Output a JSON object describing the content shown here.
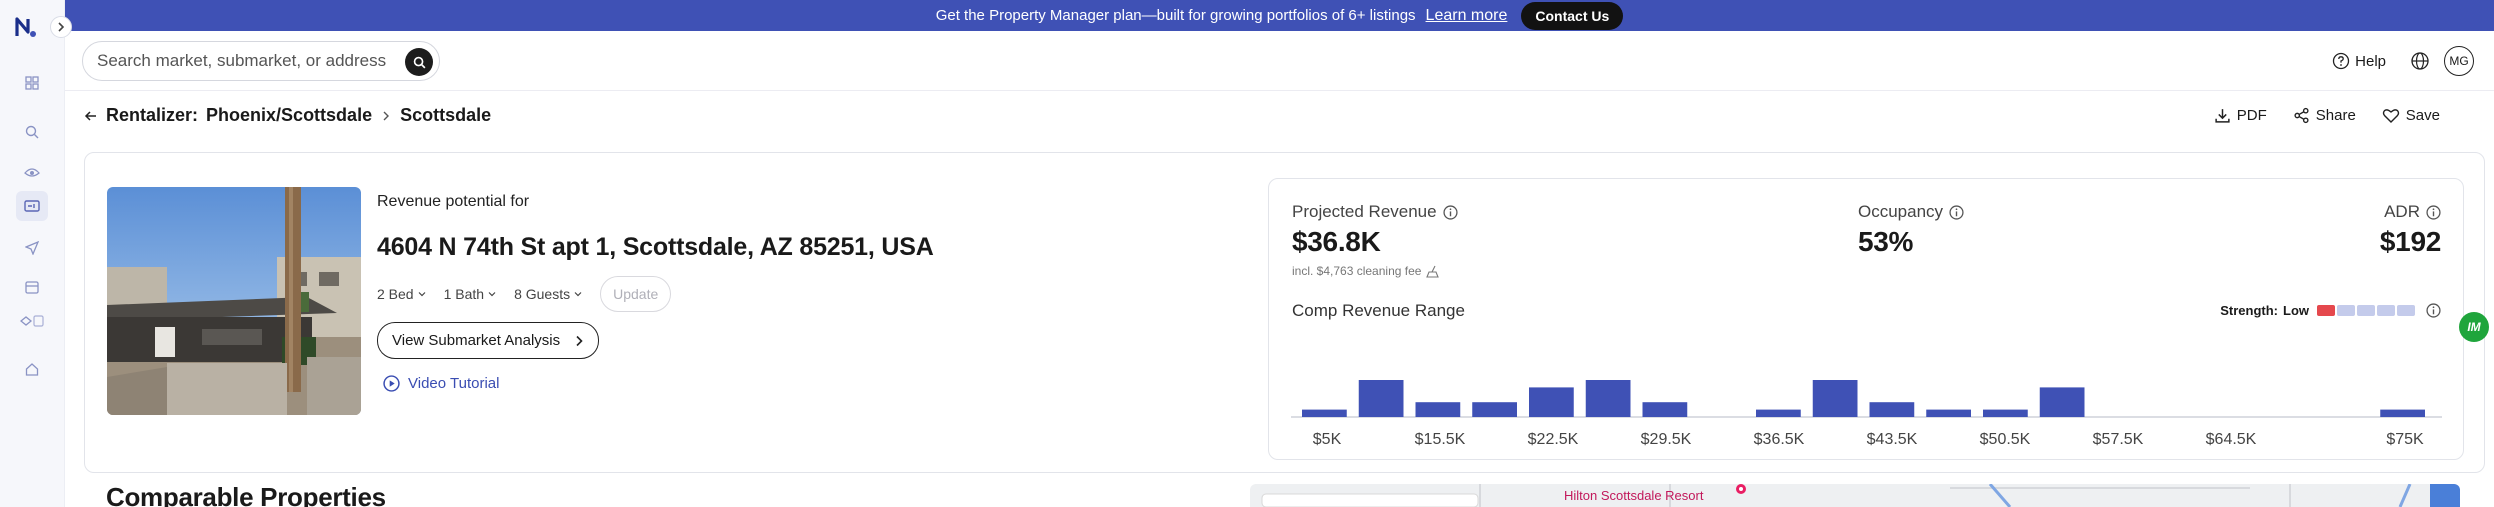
{
  "banner": {
    "message": "Get the Property Manager plan—built for growing portfolios of 6+ listings",
    "learn_more": "Learn more",
    "contact": "Contact Us",
    "color": "#3f51b5"
  },
  "search": {
    "placeholder": "Search market, submarket, or address"
  },
  "topbar": {
    "help": "Help",
    "avatar": "MG"
  },
  "breadcrumb": {
    "root": "Rentalizer:",
    "market": "Phoenix/Scottsdale",
    "submarket": "Scottsdale"
  },
  "actions": {
    "pdf": "PDF",
    "share": "Share",
    "save": "Save"
  },
  "property": {
    "revenue_potential": "Revenue potential for",
    "address": "4604 N 74th St apt 1, Scottsdale, AZ 85251, USA",
    "beds": "2 Bed",
    "baths": "1 Bath",
    "guests": "8 Guests",
    "update": "Update",
    "view_submarket": "View Submarket Analysis",
    "video_tutorial": "Video Tutorial"
  },
  "metrics": {
    "projected_revenue_label": "Projected Revenue",
    "projected_revenue": "$36.8K",
    "cleaning_fee": "incl. $4,763 cleaning fee",
    "occupancy_label": "Occupancy",
    "occupancy": "53%",
    "adr_label": "ADR",
    "adr": "$192"
  },
  "comp_range": {
    "title": "Comp Revenue Range",
    "strength_label": "Strength:",
    "strength_value": "Low",
    "strength_level": 1,
    "strength_max": 5,
    "bar_color": "#3f51b5",
    "tick_labels": [
      "$5K",
      "$15.5K",
      "$22.5K",
      "$29.5K",
      "$36.5K",
      "$43.5K",
      "$50.5K",
      "$57.5K",
      "$64.5K",
      "$75K"
    ],
    "bins": [
      1,
      5,
      2,
      2,
      4,
      5,
      2,
      0,
      1,
      5,
      2,
      1,
      1,
      4,
      0,
      0,
      0,
      0,
      0,
      1
    ]
  },
  "comparables": {
    "title": "Comparable Properties",
    "map_place": "Hilton Scottsdale Resort"
  }
}
